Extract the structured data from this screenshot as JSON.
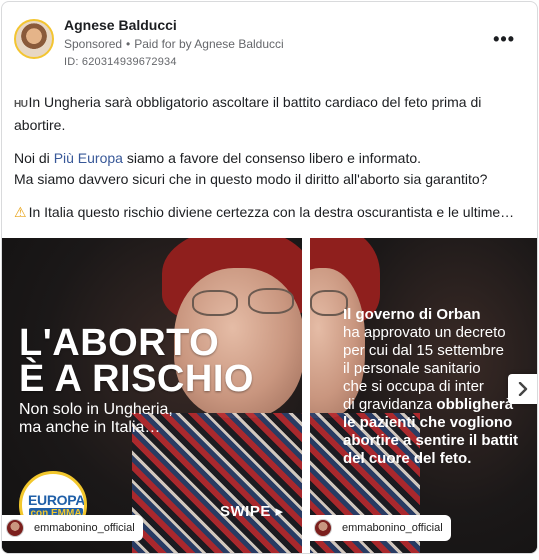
{
  "post": {
    "author": "Agnese Balducci",
    "sponsored": "Sponsored",
    "paid_for": "Paid for by Agnese Balducci",
    "ad_id": "ID: 620314939672934",
    "more_label": "•••"
  },
  "text": {
    "line1_flag": "HU",
    "line1": "In Ungheria sarà obbligatorio ascoltare il battito cardiaco del feto prima di abortire.",
    "p2_prefix": "Noi di ",
    "p2_link": "Più Europa",
    "p2_suffix": " siamo a favore del consenso libero e informato.",
    "p2_line2": "Ma siamo davvero sicuri che in questo modo il diritto all'aborto sia garantito?",
    "p3_icon": "⚠",
    "p3": "In Italia questo rischio diviene certezza con la destra oscurantista e le ultime…"
  },
  "slides": [
    {
      "headline_line1": "L'ABORTO",
      "headline_line2": "È A RISCHIO",
      "subtitle_line1": "Non solo in Ungheria,",
      "subtitle_line2": "ma anche in Italia…",
      "logo_top": "EUROPA",
      "logo_bottom": "con EMMA BONINO",
      "swipe": "SWIPE ▸",
      "handle": "emmabonino_official"
    },
    {
      "lines": [
        {
          "bold": "Il governo di Orban",
          "normal": ""
        },
        {
          "bold": "",
          "normal": "ha approvato un decreto"
        },
        {
          "bold": "",
          "normal": "per cui dal 15 settembre"
        },
        {
          "bold": "",
          "normal": "il personale sanitario"
        },
        {
          "bold": "",
          "normal": "che si occupa di inter"
        },
        {
          "bold": "",
          "normal": "di gravidanza ",
          "bold2": "obbligherà"
        },
        {
          "bold": "le pazienti che vogliono",
          "normal": ""
        },
        {
          "bold": "abortire a sentire il battit",
          "normal": ""
        },
        {
          "bold": "del cuore del feto.",
          "normal": ""
        }
      ],
      "handle": "emmabonino_official"
    }
  ],
  "icons": {
    "more": "more-options-icon",
    "next": "chevron-right-icon",
    "warning": "warning-icon"
  }
}
